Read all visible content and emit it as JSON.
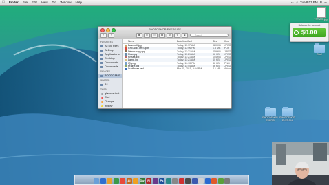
{
  "menubar": {
    "app": "Finder",
    "menus": [
      "File",
      "Edit",
      "View",
      "Go",
      "Window",
      "Help"
    ],
    "clock": "Tue 8:07 PM"
  },
  "finder": {
    "title": "PHOTOSHOP-EXERCISE",
    "search_placeholder": "Search",
    "sidebar": {
      "favorites_header": "FAVORITES",
      "favorites": [
        "All My Files",
        "AirDrop",
        "Applications",
        "Desktop",
        "Documents",
        "Downloads"
      ],
      "devices_header": "DEVICES",
      "devices": [
        "BOOTCAMP"
      ],
      "shared_header": "SHARED",
      "shared": [
        "All..."
      ],
      "tags_header": "TAGS",
      "tags": [
        {
          "label": "glasses that",
          "color": "#9aa0a6"
        },
        {
          "label": "Red",
          "color": "#f04b4b"
        },
        {
          "label": "Orange",
          "color": "#f7a23b"
        },
        {
          "label": "Yellow",
          "color": "#f3d53a"
        }
      ]
    },
    "columns": {
      "name": "Name",
      "date": "Date Modified",
      "size": "Size",
      "kind": "Kind"
    },
    "files": [
      {
        "name": "Baseball.jpg",
        "date": "Today, 11:17 AM",
        "size": "320 KB",
        "kind": "JPEG",
        "icon_color": "#c9a36b"
      },
      {
        "name": "CREATE-THIS.pdf",
        "date": "Today, 12:06 PM",
        "size": "1.3 MB",
        "kind": "PDF",
        "icon_color": "#d84a3e"
      },
      {
        "name": "Dinner-copy.jpg",
        "date": "Today, 11:21 AM",
        "size": "259 KB",
        "kind": "JPEG",
        "icon_color": "#8b6b4b"
      },
      {
        "name": "Flow.jpg",
        "date": "Today, 11:21 AM",
        "size": "66 KB",
        "kind": "JPEG",
        "icon_color": "#6a8aa8"
      },
      {
        "name": "Kisses.jpg",
        "date": "Today, 11:21 AM",
        "size": "104 KB",
        "kind": "JPEG",
        "icon_color": "#b86a6a"
      },
      {
        "name": "Lamp.jpg",
        "date": "Today, 11:21 AM",
        "size": "40 KB",
        "kind": "JPEG",
        "icon_color": "#d9c07a"
      },
      {
        "name": "IQ.png",
        "date": "Today, 10:35 PM",
        "size": "46 KB",
        "kind": "PNG",
        "icon_color": "#7aa0c8"
      },
      {
        "name": "Prairie.jpg",
        "date": "Today, 11:44 AM",
        "size": "56 KB",
        "kind": "JPEG",
        "icon_color": "#8aa862"
      },
      {
        "name": "Sunflower.psd",
        "date": "Mar 11, 2015, 9:54 PM",
        "size": "2.1 MB",
        "kind": "Adobe",
        "icon_color": "#3a6fb5"
      }
    ]
  },
  "widget": {
    "title": "Balance for account",
    "balance": "$0.00"
  },
  "desktop_icons": [
    {
      "label": "TSTAMP.jpg"
    },
    {
      "label": "Stuff"
    },
    {
      "label": "PHOTOSHOP-EXERCI"
    },
    {
      "label": "PHOTOSHOP-EXERCI-2"
    }
  ],
  "dock": [
    {
      "label": "",
      "color": "#6aa0d8"
    },
    {
      "label": "",
      "color": "#2f6fd0"
    },
    {
      "label": "",
      "color": "#e8a030"
    },
    {
      "label": "",
      "color": "#3a9a4a"
    },
    {
      "label": "",
      "color": "#e84a3a"
    },
    {
      "label": "Ai",
      "color": "#c56a1e"
    },
    {
      "label": "",
      "color": "#f0a020"
    },
    {
      "label": "Dw",
      "color": "#3a7a3a"
    },
    {
      "label": "Fl",
      "color": "#b02a2a"
    },
    {
      "label": "",
      "color": "#6a3a8a"
    },
    {
      "label": "Ps",
      "color": "#1d4f9a"
    },
    {
      "label": "",
      "color": "#2a8a8a"
    },
    {
      "label": "",
      "color": "#888888"
    },
    {
      "label": "",
      "color": "#d03030"
    },
    {
      "label": "",
      "color": "#4a4a4a"
    },
    {
      "label": "",
      "color": "#3a5ab0"
    },
    {
      "label": "",
      "color": "#d0d0d0"
    },
    {
      "label": "",
      "color": "#2a6ad0"
    },
    {
      "label": "",
      "color": "#e05a2a"
    },
    {
      "label": "",
      "color": "#5aa03a"
    },
    {
      "label": "",
      "color": "#7a7a7a"
    }
  ]
}
